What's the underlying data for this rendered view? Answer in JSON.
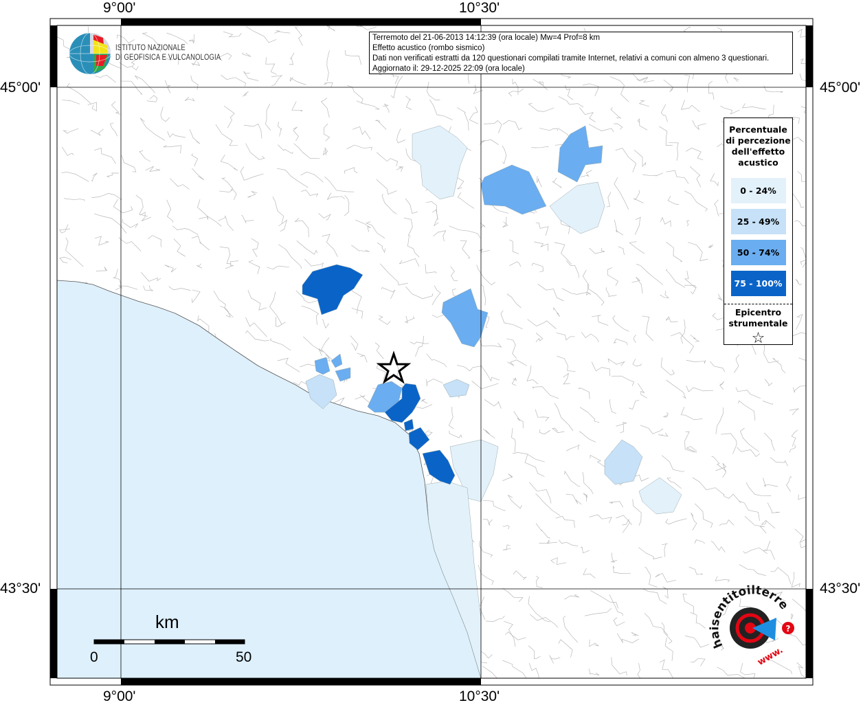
{
  "coordinates": {
    "top": [
      "9°00'",
      "10°30'"
    ],
    "bottom": [
      "9°00'",
      "10°30'"
    ],
    "left": [
      "45°00'",
      "43°30'"
    ],
    "right": [
      "45°00'",
      "43°30'"
    ]
  },
  "info": {
    "line1": "Terremoto del 21-06-2013 14:12:39 (ora locale) Mw=4 Prof=8 km",
    "line2": "Effetto acustico (rombo sismico)",
    "line3": "Dati non verificati estratti da 120 questionari compilati tramite Internet, relativi a comuni con almeno 3 questionari.",
    "line4": "Aggiornato il: 29-12-2025 22:09 (ora locale)"
  },
  "institute": {
    "line1": "ISTITUTO NAZIONALE",
    "line2": "DI GEOFISICA E VULCANOLOGIA"
  },
  "legend": {
    "title": "Percentuale di percezione dell'effetto acustico",
    "classes": [
      {
        "label": "0 - 24%",
        "color": "#e3f1fb",
        "text_color": "#000000"
      },
      {
        "label": "25 - 49%",
        "color": "#c6e1f8",
        "text_color": "#000000"
      },
      {
        "label": "50 - 74%",
        "color": "#6aadf0",
        "text_color": "#000000"
      },
      {
        "label": "75 - 100%",
        "color": "#0a64c8",
        "text_color": "#ffffff"
      }
    ],
    "epicenter_label": "Epicentro strumentale",
    "epicenter_icon": "star-outline-icon"
  },
  "scale": {
    "unit": "km",
    "start": "0",
    "end": "50"
  },
  "watermark_logo": "haisentitoilterremoto.it www",
  "colors": {
    "sea": "#def0fc",
    "border": "#b8b8b8"
  }
}
